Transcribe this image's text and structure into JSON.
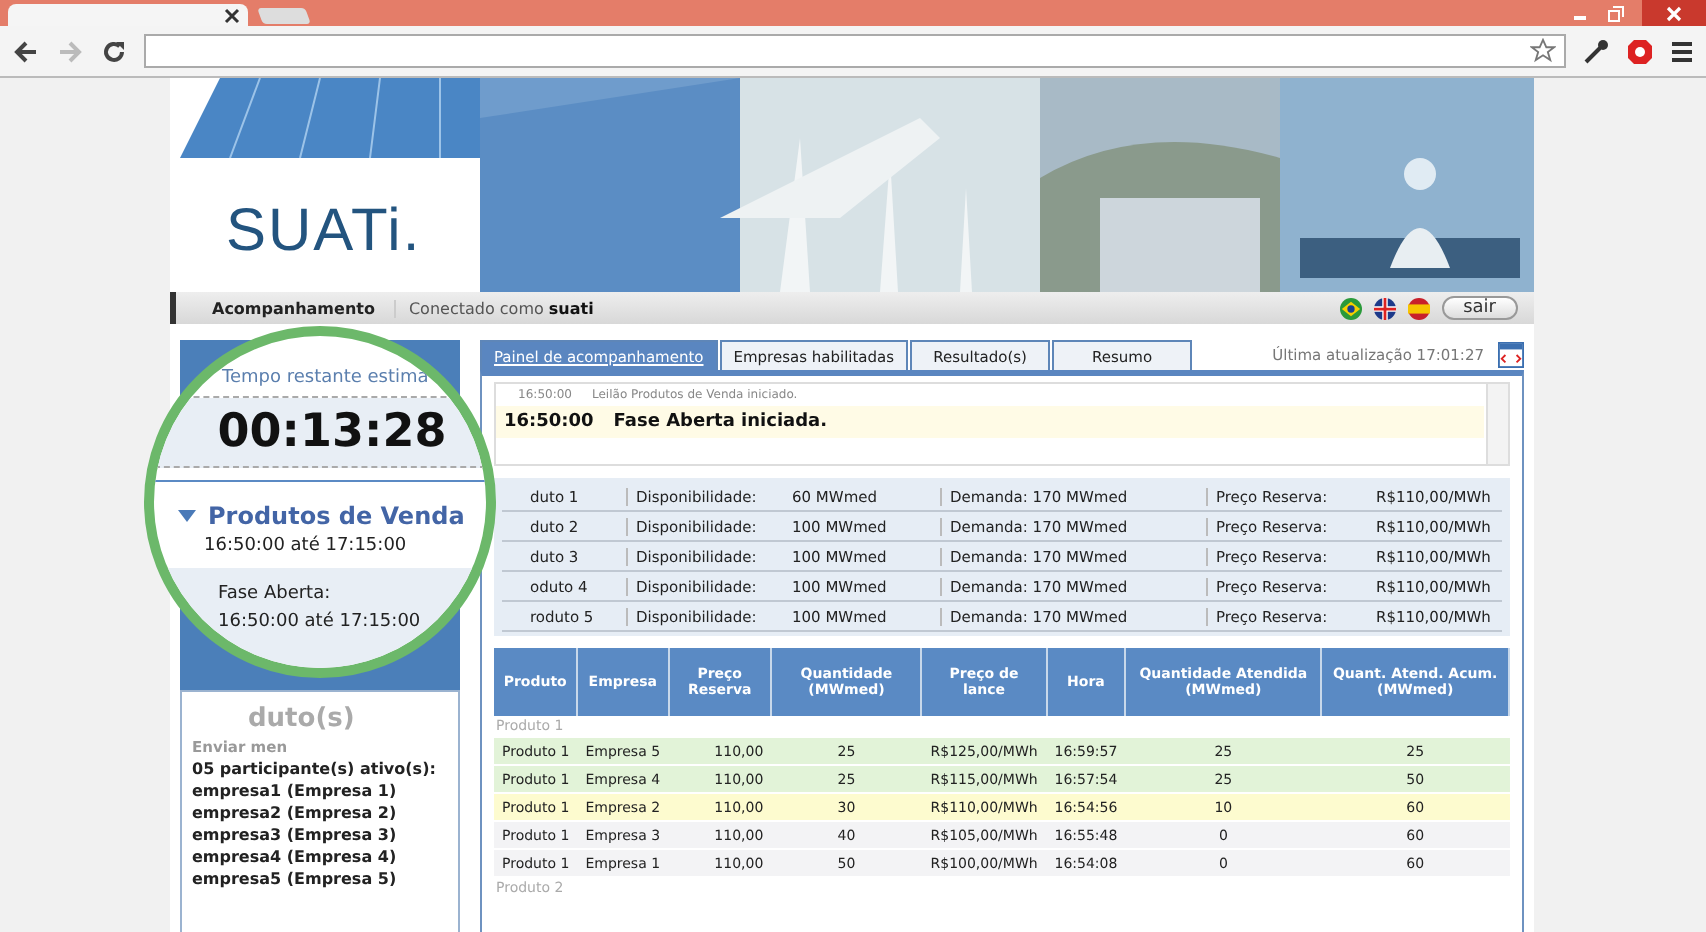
{
  "header": {
    "logo": "SUATi."
  },
  "nav": {
    "section": "Acompanhamento",
    "connected": "Conectado como **suati**",
    "logout": "sair"
  },
  "tabs": [
    {
      "label": "Painel de acompanhamento",
      "selected": true
    },
    {
      "label": "Empresas habilitadas",
      "selected": false
    },
    {
      "label": "Resultado(s)",
      "selected": false
    },
    {
      "label": "Resumo",
      "selected": false
    }
  ],
  "last_update": "Última atualização 17:01:27",
  "log": [
    {
      "time": "16:50:00",
      "text": "Leilão Produtos de Venda iniciado.",
      "highlighted": false
    },
    {
      "time": "16:50:00",
      "text": "Fase Aberta iniciada.",
      "highlighted": true
    }
  ],
  "products": [
    {
      "product": "duto 1",
      "availability_label": "Disponibilidade:",
      "availability": "60 MWmed",
      "demand": "Demanda: 170 MWmed",
      "reserve_label": "Preço Reserva:",
      "reserve": "R$110,00/MWh"
    },
    {
      "product": "duto 2",
      "availability_label": "Disponibilidade:",
      "availability": "100 MWmed",
      "demand": "Demanda: 170 MWmed",
      "reserve_label": "Preço Reserva:",
      "reserve": "R$110,00/MWh"
    },
    {
      "product": "duto 3",
      "availability_label": "Disponibilidade:",
      "availability": "100 MWmed",
      "demand": "Demanda: 170 MWmed",
      "reserve_label": "Preço Reserva:",
      "reserve": "R$110,00/MWh"
    },
    {
      "product": "oduto 4",
      "availability_label": "Disponibilidade:",
      "availability": "100 MWmed",
      "demand": "Demanda: 170 MWmed",
      "reserve_label": "Preço Reserva:",
      "reserve": "R$110,00/MWh"
    },
    {
      "product": "roduto 5",
      "availability_label": "Disponibilidade:",
      "availability": "100 MWmed",
      "demand": "Demanda: 170 MWmed",
      "reserve_label": "Preço Reserva:",
      "reserve": "R$110,00/MWh"
    }
  ],
  "bids": {
    "columns": [
      "Produto",
      "Empresa",
      "Preço Reserva",
      "Quantidade (MWmed)",
      "Preço de lance",
      "Hora",
      "Quantidade Atendida (MWmed)",
      "Quant. Atend. Acum. (MWmed)"
    ],
    "groups": [
      {
        "label": "Produto 1",
        "rows": [
          {
            "color": "#e2f3d8",
            "cells": [
              "Produto 1",
              "Empresa 5",
              "110,00",
              "25",
              "R$125,00/MWh",
              "16:59:57",
              "25",
              "25"
            ]
          },
          {
            "color": "#e2f3d8",
            "cells": [
              "Produto 1",
              "Empresa 4",
              "110,00",
              "25",
              "R$115,00/MWh",
              "16:57:54",
              "25",
              "50"
            ]
          },
          {
            "color": "#fdfbcf",
            "cells": [
              "Produto 1",
              "Empresa 2",
              "110,00",
              "30",
              "R$110,00/MWh",
              "16:54:56",
              "10",
              "60"
            ]
          },
          {
            "color": "#f3f3f5",
            "cells": [
              "Produto 1",
              "Empresa 3",
              "110,00",
              "40",
              "R$105,00/MWh",
              "16:55:48",
              "0",
              "60"
            ]
          },
          {
            "color": "#f3f3f5",
            "cells": [
              "Produto 1",
              "Empresa 1",
              "110,00",
              "50",
              "R$100,00/MWh",
              "16:54:08",
              "0",
              "60"
            ]
          }
        ]
      },
      {
        "label": "Produto 2"
      }
    ]
  },
  "left": {
    "heading": "duto(s)",
    "send_message": "Enviar men",
    "participants_title": "05 participante(s) ativo(s):",
    "participants": [
      "empresa1 (Empresa 1)",
      "empresa2 (Empresa 2)",
      "empresa3 (Empresa 3)",
      "empresa4 (Empresa 4)",
      "empresa5 (Empresa 5)"
    ]
  },
  "magnifier": {
    "time_label": "Tempo restante estima",
    "countdown": "00:13:28",
    "auction": {
      "title": "Produtos de Venda",
      "expanded": true,
      "period": "16:50:00 até 17:15:00"
    },
    "phase": {
      "label": "Fase Aberta:",
      "period": "16:50:00 até 17:15:00"
    }
  }
}
